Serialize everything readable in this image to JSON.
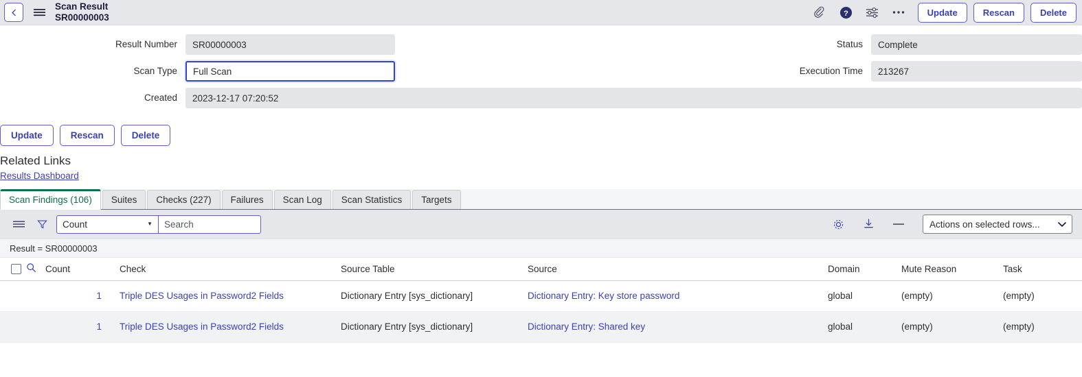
{
  "header": {
    "back_icon": "chevron-left-icon",
    "menu_icon": "hamburger-menu-icon",
    "title_line1": "Scan Result",
    "title_line2": "SR00000003",
    "icons": [
      {
        "name": "attachment-icon",
        "label": "Attachments"
      },
      {
        "name": "help-icon",
        "label": "Help"
      },
      {
        "name": "personalize-icon",
        "label": "Personalize"
      },
      {
        "name": "more-options-icon",
        "label": "More options"
      }
    ],
    "buttons": [
      {
        "name": "update-button",
        "label": "Update"
      },
      {
        "name": "rescan-button",
        "label": "Rescan"
      },
      {
        "name": "delete-button",
        "label": "Delete"
      }
    ]
  },
  "form": {
    "result_number": {
      "label": "Result Number",
      "value": "SR00000003",
      "focused": false
    },
    "scan_type": {
      "label": "Scan Type",
      "value": "Full Scan",
      "focused": true
    },
    "created": {
      "label": "Created",
      "value": "2023-12-17 07:20:52",
      "focused": false
    },
    "status": {
      "label": "Status",
      "value": "Complete",
      "focused": false
    },
    "execution_time": {
      "label": "Execution Time",
      "value": "213267",
      "focused": false
    }
  },
  "actions": {
    "update_label": "Update",
    "rescan_label": "Rescan",
    "delete_label": "Delete"
  },
  "related_links": {
    "title": "Related Links",
    "links": [
      {
        "name": "results-dashboard-link",
        "label": "Results Dashboard"
      }
    ]
  },
  "tabs": [
    {
      "name": "tab-scan-findings",
      "label": "Scan Findings (106)",
      "active": true
    },
    {
      "name": "tab-suites",
      "label": "Suites",
      "active": false
    },
    {
      "name": "tab-checks",
      "label": "Checks (227)",
      "active": false
    },
    {
      "name": "tab-failures",
      "label": "Failures",
      "active": false
    },
    {
      "name": "tab-scan-log",
      "label": "Scan Log",
      "active": false
    },
    {
      "name": "tab-scan-statistics",
      "label": "Scan Statistics",
      "active": false
    },
    {
      "name": "tab-targets",
      "label": "Targets",
      "active": false
    }
  ],
  "list_toolbar": {
    "menu_icon": "list-menu-icon",
    "filter_icon": "filter-funnel-icon",
    "field_select_value": "Count",
    "search_placeholder": "Search",
    "search_value": "",
    "gear_icon": "gear-icon",
    "export_icon": "export-download-icon",
    "collapse_icon": "minus-collapse-icon",
    "row_actions_value": "Actions on selected rows..."
  },
  "filter_breadcrumb": "Result = SR00000003",
  "table": {
    "columns": [
      {
        "name": "column-count",
        "label": "Count"
      },
      {
        "name": "column-check",
        "label": "Check"
      },
      {
        "name": "column-source-table",
        "label": "Source Table"
      },
      {
        "name": "column-source",
        "label": "Source"
      },
      {
        "name": "column-domain",
        "label": "Domain"
      },
      {
        "name": "column-mute-reason",
        "label": "Mute Reason"
      },
      {
        "name": "column-task",
        "label": "Task"
      }
    ],
    "rows": [
      {
        "count": "1",
        "check": "Triple DES Usages in Password2 Fields",
        "source_table": "Dictionary Entry [sys_dictionary]",
        "source": "Dictionary Entry: Key store password",
        "domain": "global",
        "mute_reason": "(empty)",
        "task": "(empty)"
      },
      {
        "count": "1",
        "check": "Triple DES Usages in Password2 Fields",
        "source_table": "Dictionary Entry [sys_dictionary]",
        "source": "Dictionary Entry: Shared key",
        "domain": "global",
        "mute_reason": "(empty)",
        "task": "(empty)"
      }
    ]
  },
  "colors": {
    "accent_purple": "#3a41b5",
    "accent_border": "#5b5fc7",
    "active_tab_green": "#0a7249",
    "focus_blue": "#2f43d8",
    "header_bg": "#e6e7eb",
    "field_bg": "#e4e5e9",
    "row_alt_bg": "#f1f2f4"
  }
}
